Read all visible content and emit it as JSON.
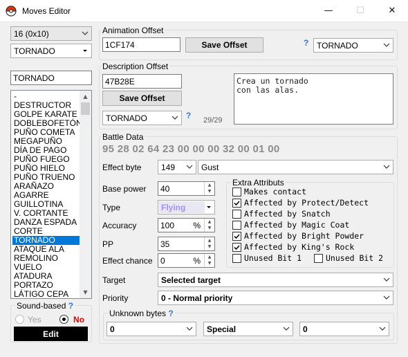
{
  "window": {
    "title": "Moves Editor",
    "minimize": "—",
    "maximize": "☐",
    "close": "✕"
  },
  "left": {
    "move_index": "16 (0x10)",
    "move_combo": "TORNADO",
    "name_input": "TORNADO",
    "moves": [
      "-",
      "DESTRUCTOR",
      "GOLPE KARATE",
      "DOBLEBOFETÓN",
      "PUÑO COMETA",
      "MEGAPUÑO",
      "DÍA DE PAGO",
      "PUÑO FUEGO",
      "PUÑO HIELO",
      "PUÑO TRUENO",
      "ARAÑAZO",
      "AGARRE",
      "GUILLOTINA",
      "V. CORTANTE",
      "DANZA ESPADA",
      "CORTE",
      "TORNADO",
      "ATAQUE ALA",
      "REMOLINO",
      "VUELO",
      "ATADURA",
      "PORTAZO",
      "LÁTIGO CEPA"
    ],
    "selected_index": 16,
    "sound_based": {
      "title": "Sound-based",
      "help": "?",
      "yes": "Yes",
      "no": "No",
      "selected": "No"
    },
    "edit_button": "Edit"
  },
  "animation": {
    "title": "Animation Offset",
    "offset": "1CF174",
    "save_label": "Save Offset",
    "help": "?",
    "combo": "TORNADO"
  },
  "description": {
    "title": "Description Offset",
    "offset": "47B28E",
    "save_label": "Save Offset",
    "combo": "TORNADO",
    "help": "?",
    "counter": "29/29",
    "text_line1": "Crea un tornado",
    "text_line2": "con las alas."
  },
  "battle": {
    "title": "Battle Data",
    "bytes": "95 28 02 64 23 00 00 00 32 00 01 00",
    "effect_label": "Effect byte",
    "effect_value": "149",
    "effect_name": "Gust",
    "power_label": "Base power",
    "power_value": "40",
    "type_label": "Type",
    "type_value": "Flying",
    "accuracy_label": "Accuracy",
    "accuracy_value": "100",
    "accuracy_unit": "%",
    "pp_label": "PP",
    "pp_value": "35",
    "chance_label": "Effect chance",
    "chance_value": "0",
    "chance_unit": "%",
    "target_label": "Target",
    "target_value": "Selected target",
    "priority_label": "Priority",
    "priority_value": "0 - Normal priority",
    "extra": {
      "title": "Extra Attributs",
      "items": [
        {
          "label": "Makes contact",
          "checked": false
        },
        {
          "label": "Affected by Protect/Detect",
          "checked": true
        },
        {
          "label": "Affected by Snatch",
          "checked": false
        },
        {
          "label": "Affected by Magic Coat",
          "checked": false
        },
        {
          "label": "Affected by Bright Powder",
          "checked": true
        },
        {
          "label": "Affected by King's Rock",
          "checked": true
        },
        {
          "label": "Unused Bit 1",
          "checked": false
        },
        {
          "label": "Unused Bit 2",
          "checked": false
        }
      ]
    },
    "unknown": {
      "title": "Unknown bytes",
      "help": "?",
      "values": [
        "0",
        "Special",
        "0"
      ]
    }
  },
  "colors": {
    "accent": "#0078d7",
    "type_flying": "#a890f0",
    "help": "#3a74c4"
  }
}
